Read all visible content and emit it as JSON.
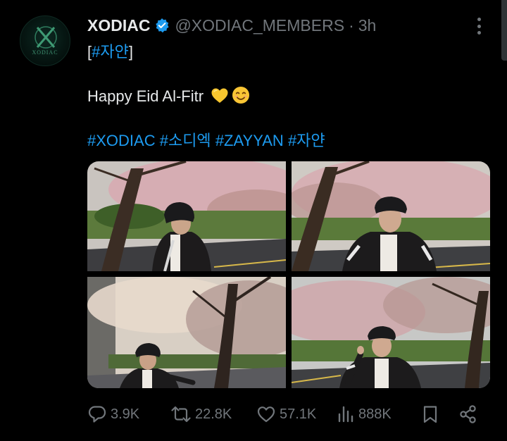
{
  "tweet": {
    "display_name": "XODIAC",
    "handle": "@XODIAC_MEMBERS",
    "separator": "·",
    "time": "3h",
    "avatar": {
      "logo_text": "XODIAC",
      "icon": "xodiac-logo-icon"
    },
    "verified_icon": "verified-badge-icon",
    "text": {
      "open_bracket": "[",
      "tag_name": "#자얀",
      "close_bracket": "]",
      "message": "Happy Eid Al-Fitr",
      "emojis": [
        "yellow-heart-icon",
        "smiling-face-icon"
      ],
      "hashtags": [
        "#XODIAC",
        "#소디엑",
        "#ZAYYAN",
        "#자얀"
      ]
    },
    "photos": [
      {
        "name": "photo-1",
        "description": "cherry-blossom-road-cap-pose-1"
      },
      {
        "name": "photo-2",
        "description": "cherry-blossom-road-cap-pose-2"
      },
      {
        "name": "photo-3",
        "description": "cherry-blossom-road-cap-pose-3"
      },
      {
        "name": "photo-4",
        "description": "cherry-blossom-road-cap-pose-4"
      }
    ],
    "actions": {
      "replies": "3.9K",
      "retweets": "22.8K",
      "likes": "57.1K",
      "views": "888K"
    }
  },
  "colors": {
    "background": "#000000",
    "text_primary": "#e7e9ea",
    "text_secondary": "#71767b",
    "link": "#1d9bf0",
    "verified": "#1d9bf0"
  }
}
